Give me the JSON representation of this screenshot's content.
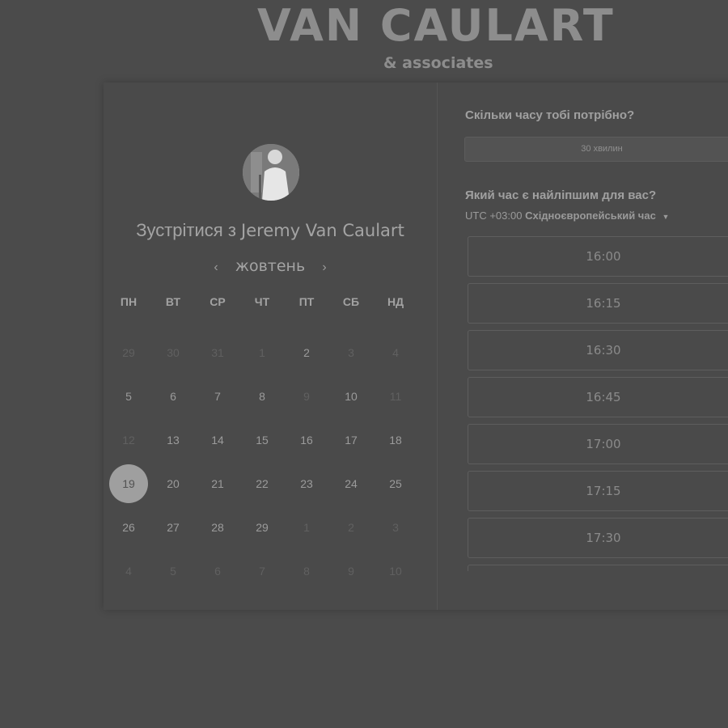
{
  "brand": {
    "title": "VAN CAULART",
    "subtitle": "& associates"
  },
  "profile": {
    "meet_prefix": "Зустрітися з",
    "host_name": "Jeremy Van Caulart"
  },
  "calendar": {
    "month": "жовтень",
    "weekdays": [
      "ПН",
      "ВТ",
      "СР",
      "ЧТ",
      "ПТ",
      "СБ",
      "НД"
    ],
    "weeks": [
      [
        {
          "d": "29",
          "m": true
        },
        {
          "d": "30",
          "m": true
        },
        {
          "d": "31",
          "m": true
        },
        {
          "d": "1",
          "m": true
        },
        {
          "d": "2",
          "m": false
        },
        {
          "d": "3",
          "m": true
        },
        {
          "d": "4",
          "m": true
        }
      ],
      [
        {
          "d": "5",
          "m": false
        },
        {
          "d": "6",
          "m": false
        },
        {
          "d": "7",
          "m": false
        },
        {
          "d": "8",
          "m": false
        },
        {
          "d": "9",
          "m": true
        },
        {
          "d": "10",
          "m": false
        },
        {
          "d": "11",
          "m": true
        }
      ],
      [
        {
          "d": "12",
          "m": true
        },
        {
          "d": "13",
          "m": false
        },
        {
          "d": "14",
          "m": false
        },
        {
          "d": "15",
          "m": false
        },
        {
          "d": "16",
          "m": false
        },
        {
          "d": "17",
          "m": false
        },
        {
          "d": "18",
          "m": false
        }
      ],
      [
        {
          "d": "19",
          "m": false,
          "sel": true
        },
        {
          "d": "20",
          "m": false
        },
        {
          "d": "21",
          "m": false
        },
        {
          "d": "22",
          "m": false
        },
        {
          "d": "23",
          "m": false
        },
        {
          "d": "24",
          "m": false
        },
        {
          "d": "25",
          "m": false
        }
      ],
      [
        {
          "d": "26",
          "m": false
        },
        {
          "d": "27",
          "m": false
        },
        {
          "d": "28",
          "m": false
        },
        {
          "d": "29",
          "m": false
        },
        {
          "d": "1",
          "m": true
        },
        {
          "d": "2",
          "m": true
        },
        {
          "d": "3",
          "m": true
        }
      ],
      [
        {
          "d": "4",
          "m": true
        },
        {
          "d": "5",
          "m": true
        },
        {
          "d": "6",
          "m": true
        },
        {
          "d": "7",
          "m": true
        },
        {
          "d": "8",
          "m": true
        },
        {
          "d": "9",
          "m": true
        },
        {
          "d": "10",
          "m": true
        }
      ]
    ]
  },
  "booking": {
    "duration_question": "Скільки часу тобі потрібно?",
    "duration_value": "30 хвилин",
    "time_question": "Який час є найліпшим для вас?",
    "tz_offset": "UTC +03:00",
    "tz_name": "Східноєвропейський час",
    "slots": [
      "16:00",
      "16:15",
      "16:30",
      "16:45",
      "17:00",
      "17:15",
      "17:30",
      ""
    ]
  }
}
